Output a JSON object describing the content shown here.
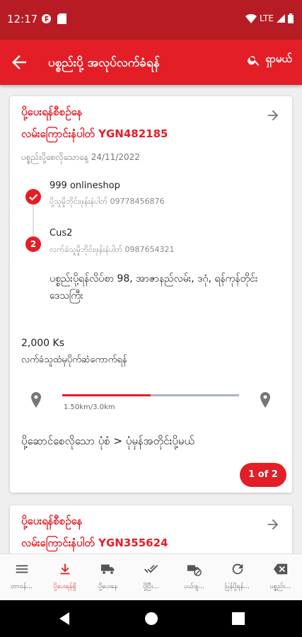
{
  "status_bar": {
    "time": "12:17",
    "network": "LTE"
  },
  "app_bar": {
    "title": "ပစ္စည်းပို့ အလုပ်လက်ခံရန်",
    "search_label": "ရှာမယ်"
  },
  "cards": [
    {
      "status": "ပို့ပေးရန်စီစဉ်နေ",
      "tracking": "လမ်းကြောင်းနံပါတ် YGN482185",
      "date": "ပစ္စည်းပို့စေလိုသောနေ့ 24/11/2022",
      "sender_name": "999 onlineshop",
      "sender_phone": "ပို့သူမှိုဘိုင်းဖုန်းနံပါတ် 09778456876",
      "step2_number": "2",
      "receiver_name": "Cus2",
      "receiver_phone": "လက်ခံသူမှိုဘိုင်းဖုန်းနံပါတ် 0987654321",
      "address": "ပစ္စည်းပို့ရန်လိပ်စာ 98, အာဇာနည်လမ်း, ဒဂုံ, ရန်ကုန်တိုင်းဒေသကြီး",
      "amount": "2,000 Ks",
      "payment_note": "လက်ခံသူထံမှပိုက်ဆံကောက်ရန်",
      "distance_label": "1.50km/3.0km",
      "distance_fraction": 0.5,
      "delivery_type": "ပို့ဆောင်စေလိုသော ပုံစံ > ပုံမှန်အတိုင်းပို့မယ်",
      "page_badge": "1 of 2"
    },
    {
      "status": "ပို့ပေးရန်စီစဉ်နေ",
      "tracking": "လမ်းကြောင်းနံပါတ် YGN355624"
    }
  ],
  "bottom_nav": [
    {
      "label": "တာဝန်...",
      "icon": "list-icon",
      "active": false
    },
    {
      "label": "ပို့ပေးရန်ရှိ",
      "icon": "download-icon",
      "active": true
    },
    {
      "label": "ပို့ပေးနေ",
      "icon": "truck-icon",
      "active": false
    },
    {
      "label": "ပို့ပြီး...",
      "icon": "double-check-icon",
      "active": false
    },
    {
      "label": "ပယ်ဖျ...",
      "icon": "cancel-delivery-icon",
      "active": false
    },
    {
      "label": "ပြန်ပို့ရန်...",
      "icon": "refresh-icon",
      "active": false
    },
    {
      "label": "ပစ္စည်း...",
      "icon": "backspace-icon",
      "active": false
    }
  ],
  "colors": {
    "primary": "#e31e26",
    "status_bar": "#b71c25",
    "track": "#aab4be"
  }
}
